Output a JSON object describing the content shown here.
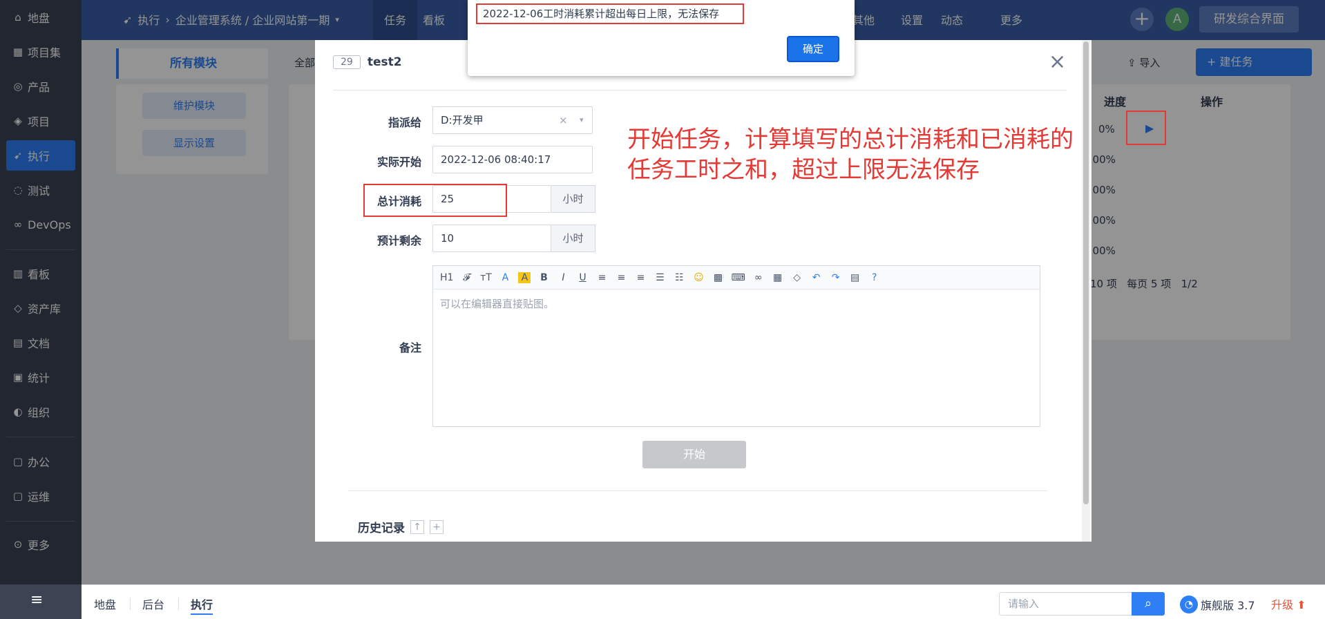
{
  "sidebar": {
    "items": [
      {
        "label": "地盘",
        "icon": "home-icon",
        "glyph": "⌂"
      },
      {
        "label": "项目集",
        "icon": "grid-icon",
        "glyph": "▦"
      },
      {
        "label": "产品",
        "icon": "bulb-icon",
        "glyph": "◎"
      },
      {
        "label": "项目",
        "icon": "rocket-icon",
        "glyph": "◈"
      },
      {
        "label": "执行",
        "icon": "run-icon",
        "glyph": "➹"
      },
      {
        "label": "测试",
        "icon": "search-icon",
        "glyph": "◌"
      },
      {
        "label": "DevOps",
        "icon": "infinity-icon",
        "glyph": "∞"
      },
      {
        "label": "看板",
        "icon": "kanban-icon",
        "glyph": "▥"
      },
      {
        "label": "资产库",
        "icon": "diamond-icon",
        "glyph": "◇"
      },
      {
        "label": "文档",
        "icon": "doc-icon",
        "glyph": "▤"
      },
      {
        "label": "统计",
        "icon": "chart-icon",
        "glyph": "▣"
      },
      {
        "label": "组织",
        "icon": "user-icon",
        "glyph": "◐"
      },
      {
        "label": "办公",
        "icon": "oa-icon",
        "glyph": "▢"
      },
      {
        "label": "运维",
        "icon": "ops-icon",
        "glyph": "▢"
      },
      {
        "label": "更多",
        "icon": "more-icon",
        "glyph": "⊙"
      }
    ]
  },
  "topbar": {
    "run_label": "执行",
    "crumb": "企业管理系统 / 企业网站第一期",
    "tabs": [
      "任务",
      "看板"
    ],
    "right_tabs": [
      "其他",
      "设置",
      "动态",
      "更多"
    ],
    "avatar": "A",
    "view_button": "研发综合界面"
  },
  "main": {
    "module_tab": "所有模块",
    "maintain_button": "维护模块",
    "display_button": "显示设置",
    "all_label": "全部",
    "import_label": "导入",
    "create_button": "建任务",
    "col_progress": "进度",
    "col_actions": "操作",
    "progress_values": [
      "0%",
      "100%",
      "100%",
      "100%",
      "100%"
    ],
    "pager_total": "10 项",
    "pager_per_page": "每页",
    "pager_per_page_count": "5 项",
    "pager_page": "1/2"
  },
  "modal": {
    "task_id": "29",
    "task_title": "test2",
    "assign_label": "指派给",
    "assign_value": "D:开发甲",
    "start_label": "实际开始",
    "start_value": "2022-12-06 08:40:17",
    "consumed_label": "总计消耗",
    "consumed_value": "25",
    "consumed_unit": "小时",
    "left_label": "预计剩余",
    "left_value": "10",
    "left_unit": "小时",
    "comment_label": "备注",
    "editor_placeholder": "可以在编辑器直接贴图。",
    "editor_heading": "H1",
    "start_button": "开始",
    "history_label": "历史记录"
  },
  "annotation": {
    "line1": "开始任务，计算填写的总计消耗和已消耗的",
    "line2": "任务工时之和，超过上限无法保存"
  },
  "alert": {
    "message": "2022-12-06工时消耗累计超出每日上限，无法保存",
    "ok_button": "确定"
  },
  "footer": {
    "items": [
      "地盘",
      "后台",
      "执行"
    ],
    "search_placeholder": "请输入",
    "edition": "旗舰版 3.7",
    "upgrade": "升级"
  },
  "colors": {
    "accent": "#2e7ff6",
    "sidebar": "#3c4353",
    "header": "#3a5fa8",
    "annotation_red": "#e53935"
  }
}
